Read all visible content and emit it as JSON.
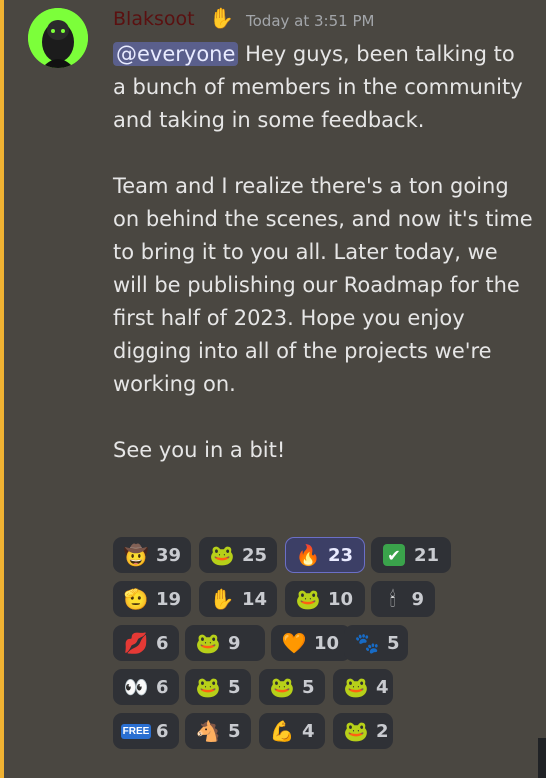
{
  "message": {
    "username": "Blaksoot",
    "timestamp": "Today at 3:51 PM",
    "mention": "@everyone",
    "text_after_mention": " Hey guys, been talking to a bunch of members in the community and taking in some feedback.\n\nTeam and I realize there's a ton going on behind the scenes, and now it's time to bring it to you all. Later today, we will be publishing our Roadmap for the first half of 2023. Hope you enjoy digging into all of the projects we're working on.\n\nSee you in a bit!"
  },
  "reactions": [
    [
      {
        "icon": "pepe-sheriff-icon",
        "glyph": "🤠",
        "count": "39"
      },
      {
        "icon": "pepe-frog-icon",
        "glyph": "🐸",
        "count": "25"
      },
      {
        "icon": "fire-icon",
        "glyph": "🔥",
        "count": "23",
        "active": true
      },
      {
        "icon": "check-mark-icon",
        "glyph": "✔",
        "count": "21"
      }
    ],
    [
      {
        "icon": "saluting-face-icon",
        "glyph": "🫡",
        "count": "19"
      },
      {
        "icon": "black-hand-icon",
        "glyph": "✋",
        "count": "14"
      },
      {
        "icon": "pepe-green-icon",
        "glyph": "🐸",
        "count": "10"
      },
      {
        "icon": "candle-icon",
        "glyph": "🕯",
        "count": "9"
      }
    ],
    [
      {
        "icon": "lips-icon",
        "glyph": "💋",
        "count": "6"
      },
      {
        "icon": "pepe-blue-icon",
        "glyph": "🐸",
        "count": "9"
      },
      {
        "icon": "dripping-heart-icon",
        "glyph": "🧡",
        "count": "10"
      },
      {
        "icon": "animal-icon",
        "glyph": "🐾",
        "count": "5"
      }
    ],
    [
      {
        "icon": "eyes-icon",
        "glyph": "👀",
        "count": "6"
      },
      {
        "icon": "pepe-shrug-icon",
        "glyph": "🐸",
        "count": "5"
      },
      {
        "icon": "pepe-smile-icon",
        "glyph": "🐸",
        "count": "5"
      },
      {
        "icon": "pepe-hat-icon",
        "glyph": "🐸",
        "count": "4"
      }
    ],
    [
      {
        "icon": "free-badge-icon",
        "glyph": "FREE",
        "count": "6"
      },
      {
        "icon": "white-horse-icon",
        "glyph": "🐴",
        "count": "5"
      },
      {
        "icon": "flexed-arm-icon",
        "glyph": "💪",
        "count": "4"
      },
      {
        "icon": "pepe-cop-icon",
        "glyph": "🐸",
        "count": "2"
      }
    ]
  ],
  "colors": {
    "background": "#4a4741",
    "highlight_bar": "#f0b232",
    "mention_bg": "#5a5f8c",
    "reaction_bg": "#2f3136",
    "reaction_active_bg": "#3c3f66"
  }
}
